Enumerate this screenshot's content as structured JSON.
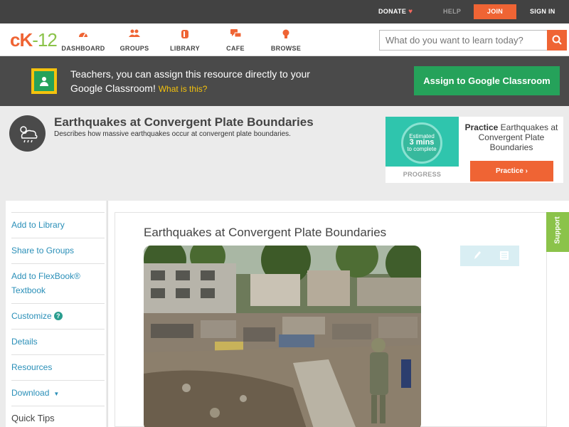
{
  "topbar": {
    "donate": "DONATE",
    "help": "HELP",
    "join": "JOIN",
    "signin": "SIGN IN"
  },
  "nav": {
    "logo_c": "c",
    "logo_k": "K",
    "logo_num": "-12",
    "items": [
      {
        "label": "DASHBOARD",
        "icon": "gauge-icon"
      },
      {
        "label": "GROUPS",
        "icon": "people-icon"
      },
      {
        "label": "LIBRARY",
        "icon": "book-icon"
      },
      {
        "label": "CAFE",
        "icon": "chat-icon"
      },
      {
        "label": "BROWSE",
        "icon": "lightbulb-icon"
      }
    ],
    "search_placeholder": "What do you want to learn today?"
  },
  "classroom": {
    "text": "Teachers, you can assign this resource directly to your Google Classroom!",
    "what": "What is this?",
    "button": "Assign to Google Classroom"
  },
  "concept": {
    "title": "Earthquakes at Convergent Plate Boundaries",
    "description": "Describes how massive earthquakes occur at convergent plate boundaries."
  },
  "practice": {
    "estimated": "Estimated",
    "time": "3 mins",
    "complete": "to complete",
    "progress": "PROGRESS",
    "title_bold": "Practice",
    "title_rest": " Earthquakes at Convergent Plate Boundaries",
    "button": "Practice"
  },
  "sidebar": {
    "items": [
      "Add to Library",
      "Share to Groups",
      "Add to FlexBook® Textbook",
      "Customize",
      "Details",
      "Resources",
      "Download",
      "Quick Tips"
    ]
  },
  "content": {
    "title": "Earthquakes at Convergent Plate Boundaries",
    "support": "Support"
  },
  "colors": {
    "brand_orange": "#ef6434",
    "google_green": "#25a25a",
    "dark_band": "#4a4a4a",
    "link_blue": "#2a8fb8",
    "support_green": "#8bc34a"
  }
}
